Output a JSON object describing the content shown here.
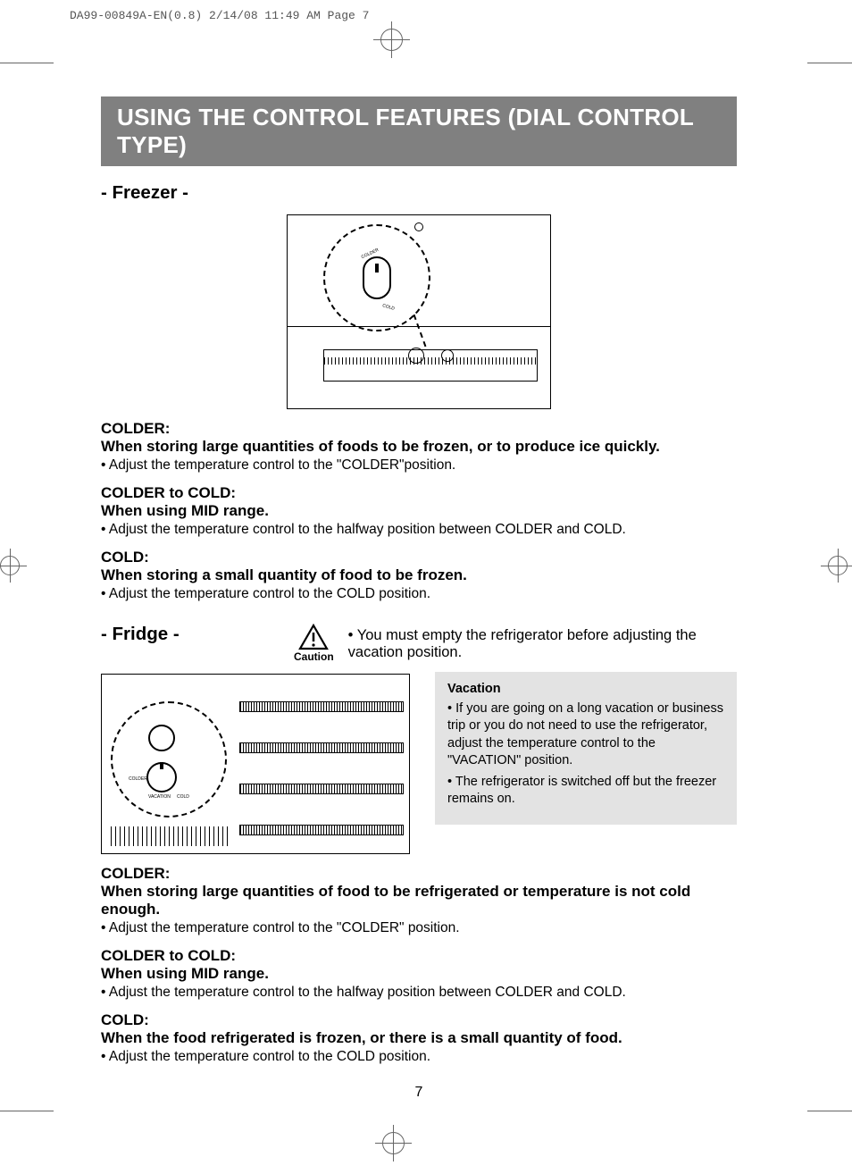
{
  "slug": "DA99-00849A-EN(0.8)  2/14/08 11:49 AM  Page 7",
  "title": "USING THE CONTROL FEATURES (DIAL CONTROL TYPE)",
  "freezer": {
    "header": "- Freezer -",
    "dial": {
      "colder": "COLDER",
      "cold": "COLD"
    },
    "colder": {
      "h": "COLDER:",
      "sub": "When storing large quantities of foods to be frozen, or to produce ice quickly.",
      "b": "• Adjust the temperature control to the \"COLDER\"position."
    },
    "mid": {
      "h": "COLDER to COLD:",
      "sub": "When using MID range.",
      "b": "• Adjust the temperature control to the halfway position between COLDER and COLD."
    },
    "cold": {
      "h": "COLD:",
      "sub": "When storing a small quantity of food to be frozen.",
      "b": "• Adjust the temperature control to the COLD position."
    }
  },
  "fridge": {
    "header": "- Fridge -",
    "caution_label": "Caution",
    "caution_text": "• You must empty the refrigerator before adjusting the vacation position.",
    "dial": {
      "colder": "COLDER",
      "cold": "COLD",
      "vacation": "VACATION"
    },
    "vacation": {
      "h": "Vacation",
      "b1": "• If you are going on a long vacation or business trip or you do not need to use the refrigerator, adjust the temperature control to the \"VACATION\" position.",
      "b2": "• The refrigerator is switched off but the freezer remains on."
    },
    "colder": {
      "h": "COLDER:",
      "sub": "When storing large quantities of food to be refrigerated or temperature is not cold enough.",
      "b": "• Adjust the temperature control to the \"COLDER\" position."
    },
    "mid": {
      "h": "COLDER to COLD:",
      "sub": "When using MID range.",
      "b": "• Adjust the temperature control to the halfway position between COLDER and COLD."
    },
    "cold": {
      "h": "COLD:",
      "sub": "When the food refrigerated is frozen, or there is a small quantity of food.",
      "b": "• Adjust the temperature control to the COLD position."
    }
  },
  "page_number": "7"
}
